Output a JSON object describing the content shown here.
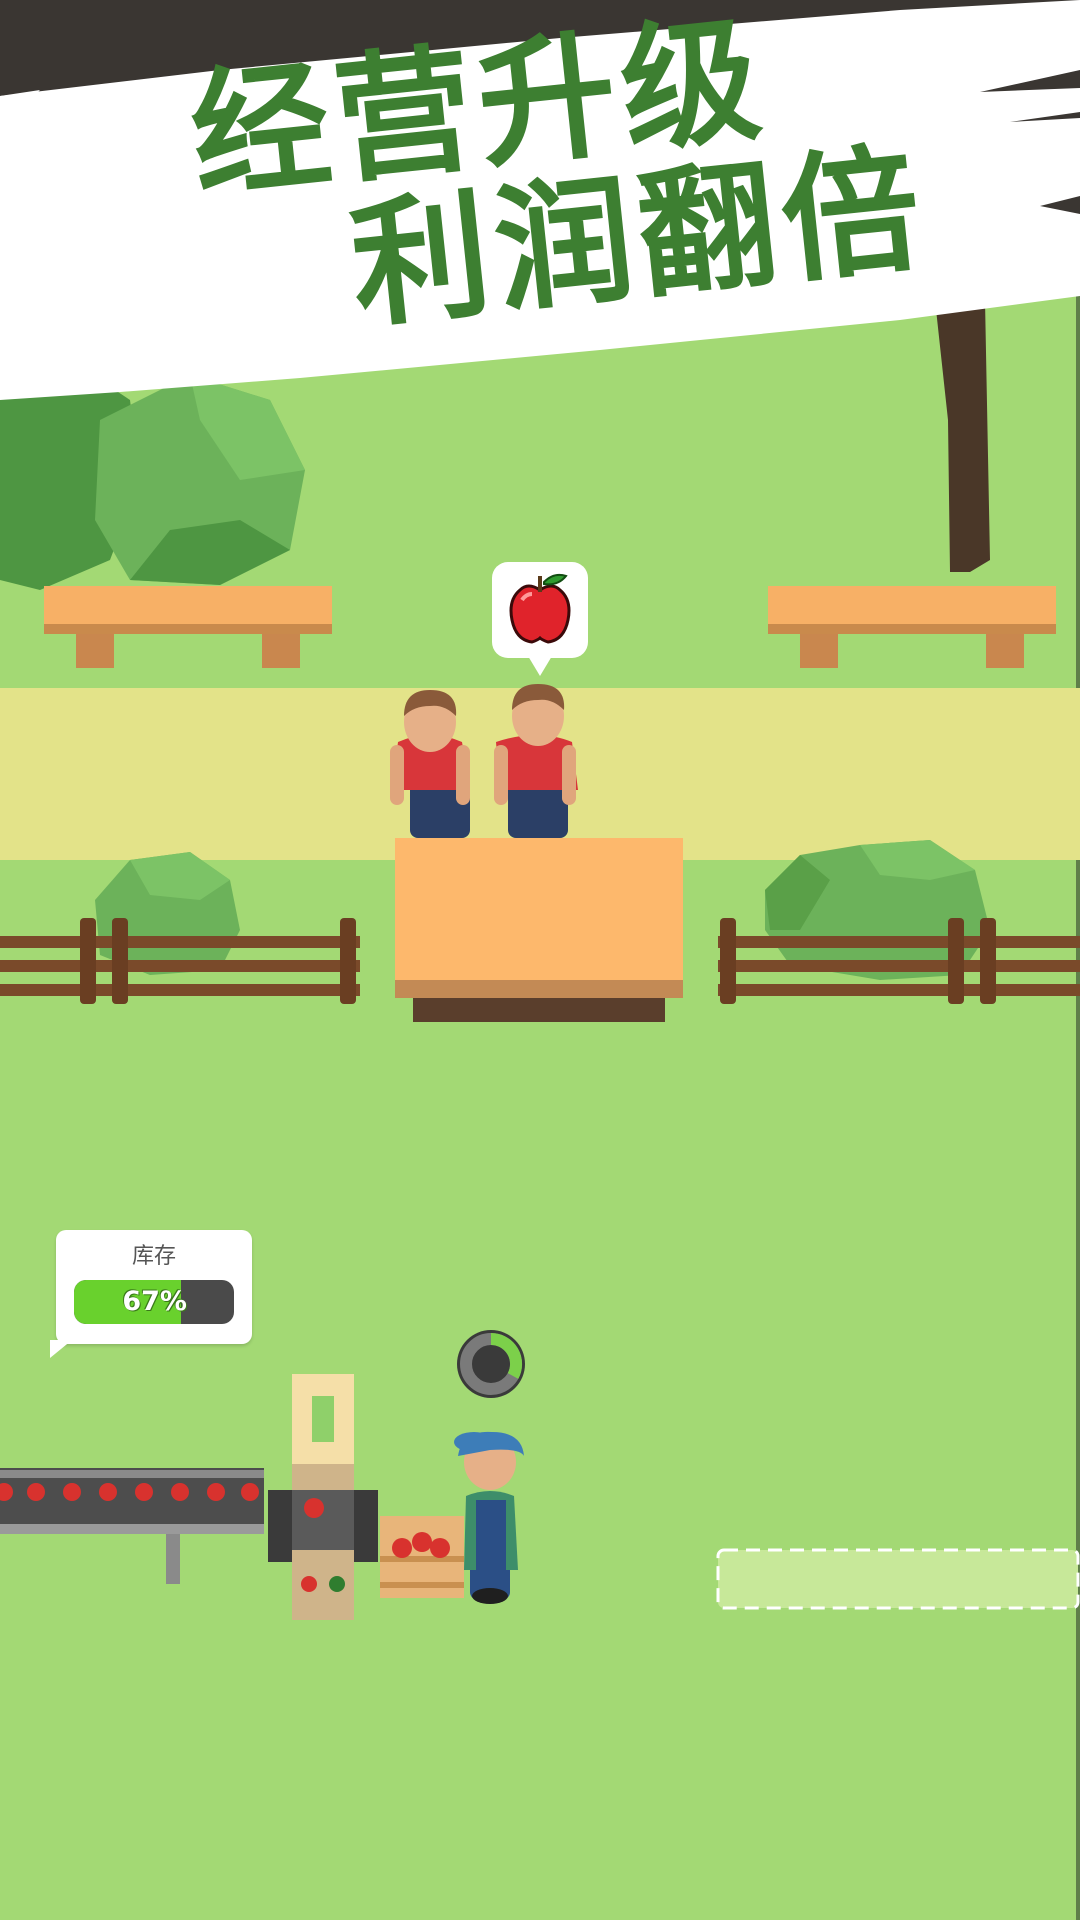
{
  "banner": {
    "line1": "经营升级",
    "line2": "利润翻倍"
  },
  "customer_request": {
    "icon": "apple-icon"
  },
  "stock": {
    "label": "库存",
    "percent_text": "67%",
    "fill_fraction": 0.67
  },
  "colors": {
    "grass": "#a3d974",
    "path": "#e3e389",
    "title_green": "#3d7f31",
    "bench_orange": "#f7b066",
    "counter_orange": "#fdb86c",
    "stock_green": "#69d12d",
    "worker_shirt": "#d8363a",
    "farmer_cap": "#3d7db8"
  }
}
